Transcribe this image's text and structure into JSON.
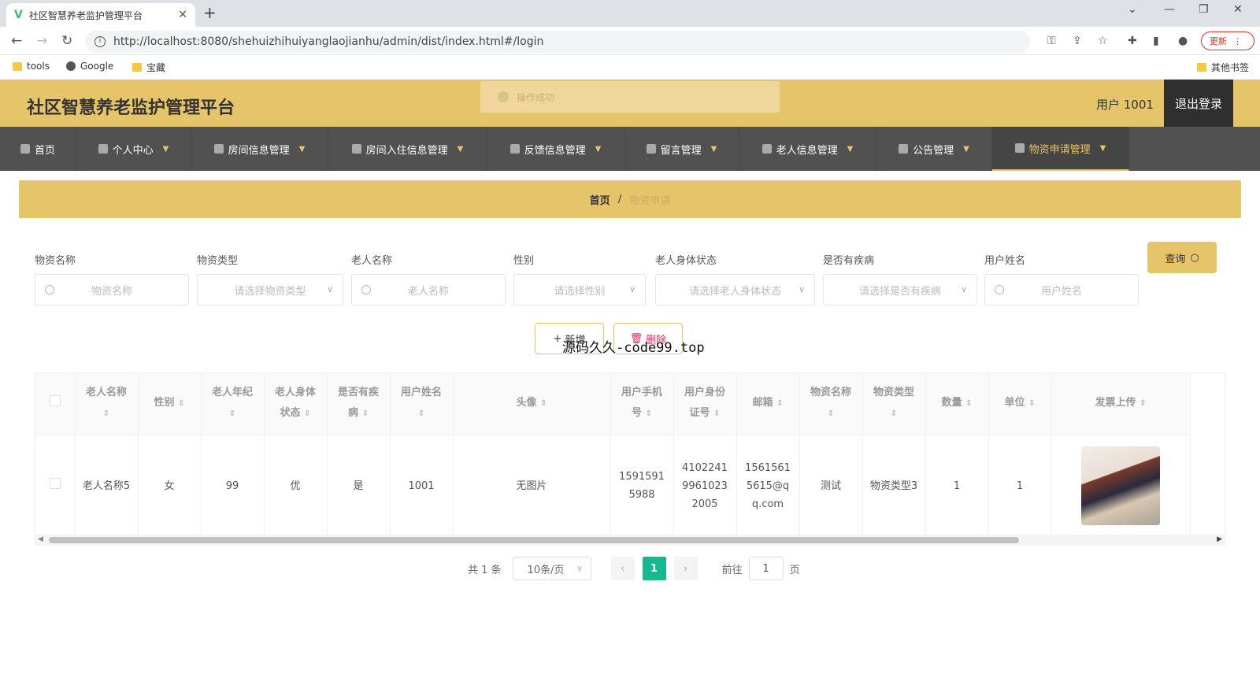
{
  "browser": {
    "tab_title": "社区智慧养老监护管理平台",
    "url": "http://localhost:8080/shehuizhihuiyanglaojianhu/admin/dist/index.html#/login",
    "update_label": "更新",
    "bookmarks": [
      "tools",
      "Google",
      "宝藏"
    ],
    "other_bookmarks": "其他书签"
  },
  "header": {
    "title": "社区智慧养老监护管理平台",
    "toast": "操作成功",
    "user": "用户 1001",
    "logout": "退出登录"
  },
  "nav": {
    "items": [
      {
        "label": "首页"
      },
      {
        "label": "个人中心"
      },
      {
        "label": "房间信息管理"
      },
      {
        "label": "房间入住信息管理"
      },
      {
        "label": "反馈信息管理"
      },
      {
        "label": "留言管理"
      },
      {
        "label": "老人信息管理"
      },
      {
        "label": "公告管理"
      },
      {
        "label": "物资申请管理"
      }
    ]
  },
  "breadcrumb": {
    "home": "首页",
    "separator": "/",
    "current": "物资申请"
  },
  "search": {
    "fields": [
      {
        "label": "物资名称",
        "placeholder": "物资名称"
      },
      {
        "label": "物资类型",
        "placeholder": "请选择物资类型"
      },
      {
        "label": "老人名称",
        "placeholder": "老人名称"
      },
      {
        "label": "性别",
        "placeholder": "请选择性别"
      },
      {
        "label": "老人身体状态",
        "placeholder": "请选择老人身体状态"
      },
      {
        "label": "是否有疾病",
        "placeholder": "请选择是否有疾病"
      },
      {
        "label": "用户姓名",
        "placeholder": "用户姓名"
      }
    ],
    "query_label": "查询"
  },
  "actions": {
    "add": "新增",
    "delete": "删除",
    "overlay": "源码久久-code99.top"
  },
  "table": {
    "headers": [
      "老人名称",
      "性别",
      "老人年纪",
      "老人身体状态",
      "是否有疾病",
      "用户姓名",
      "头像",
      "用户手机号",
      "用户身份证号",
      "邮箱",
      "物资名称",
      "物资类型",
      "数量",
      "单位",
      "发票上传"
    ],
    "rows": [
      {
        "name": "老人名称5",
        "gender": "女",
        "age": "99",
        "status": "优",
        "disease": "是",
        "username": "1001",
        "avatar": "无图片",
        "phone": "15915915988",
        "idcard": "410224199610232005",
        "email": "15615615615@qq.com",
        "item": "测试",
        "type": "物资类型3",
        "qty": "1",
        "unit": "1"
      }
    ]
  },
  "pagination": {
    "total": "共 1 条",
    "page_size": "10条/页",
    "current": "1",
    "goto_label": "前往",
    "goto_value": "1",
    "page_suffix": "页"
  },
  "colors": {
    "accent": "#e6c46a",
    "nav_bg": "#515151",
    "page_active": "#17b890"
  }
}
